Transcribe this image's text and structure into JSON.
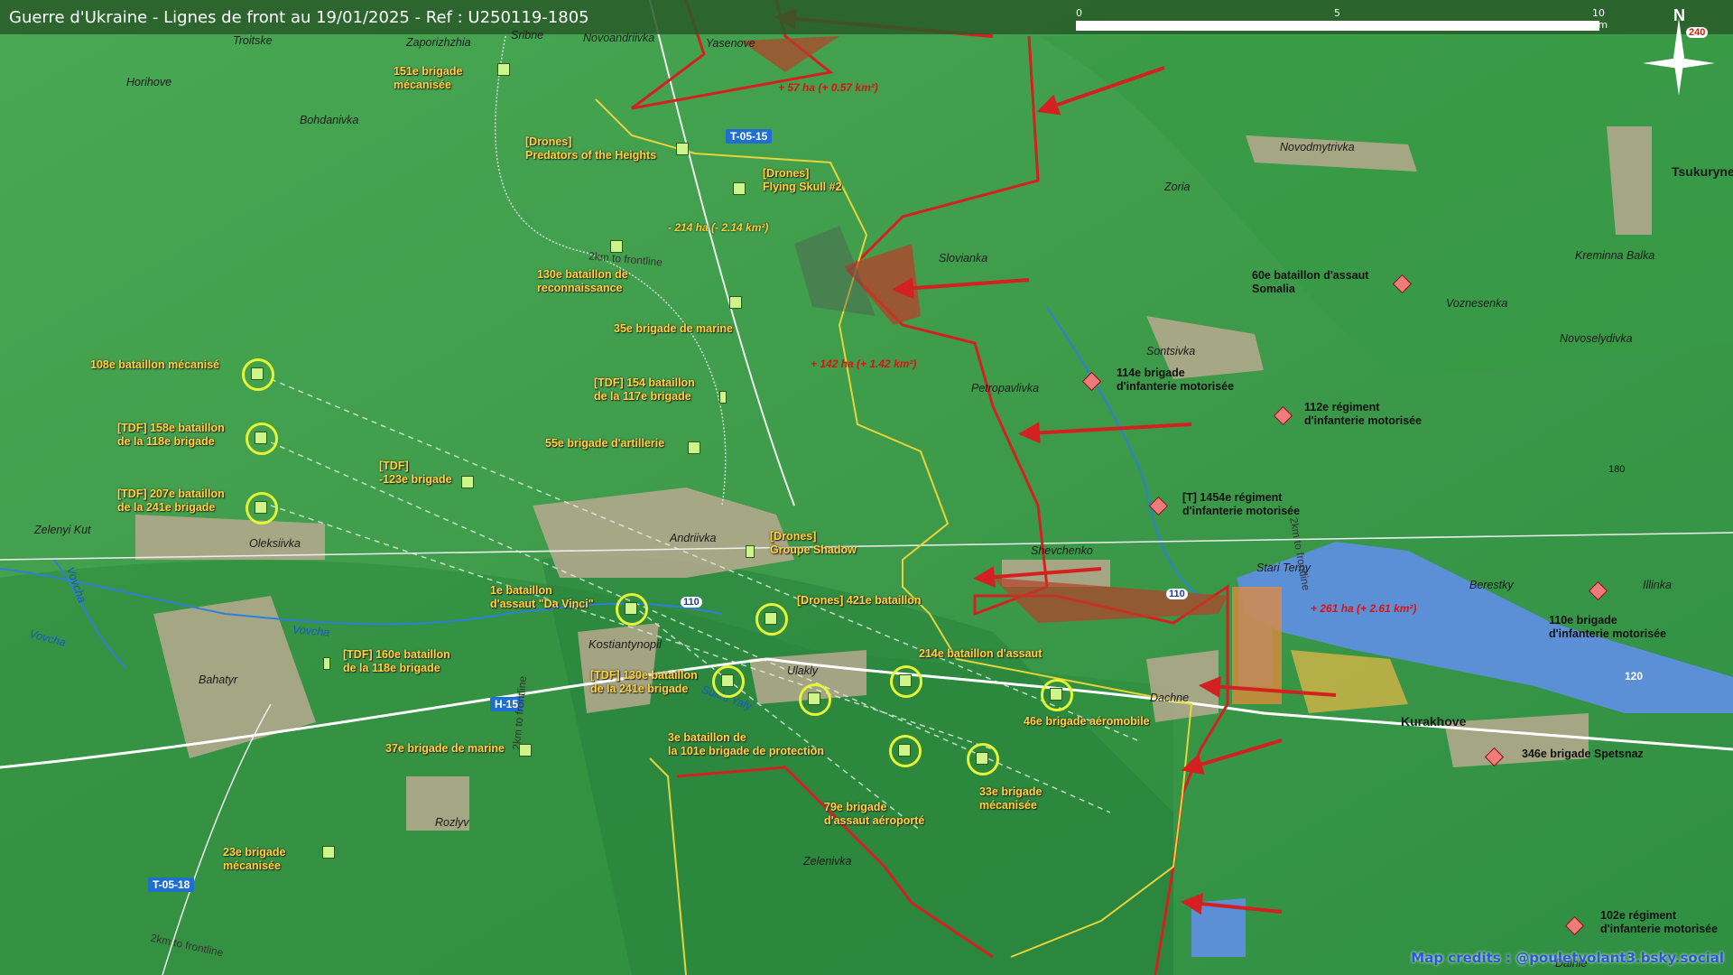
{
  "title": "Guerre d'Ukraine - Lignes de front au 19/01/2025 - Ref : U250119-1805",
  "scale": {
    "ticks": [
      "0",
      "5",
      "10 km"
    ]
  },
  "north": {
    "letter": "N",
    "road_badge": "240"
  },
  "towns": {
    "troitske": "Troitske",
    "zaporizhzhia": "Zaporizhzhia",
    "sribne": "Sribne",
    "novoandriivka": "Novoandriivka",
    "yasenove": "Yasenove",
    "horihove": "Horihove",
    "bohdanivka": "Bohdanivka",
    "novodmytrivka": "Novodmytrivka",
    "tsukuryne": "Tsukuryne",
    "zoria": "Zoria",
    "slovianka": "Slovianka",
    "kreminna_balka": "Kreminna Balka",
    "voznesenka": "Voznesenka",
    "novoselydivka": "Novoselydivka",
    "sontsivka": "Sontsivka",
    "petropavlivka": "Petropavlivka",
    "zelenyi_kut": "Zelenyi Kut",
    "oleksiivka": "Oleksiivka",
    "andriivka": "Andriivka",
    "shevchenko": "Shevchenko",
    "stari_terny": "Stari Terny",
    "berestky": "Berestky",
    "illinka": "Illinka",
    "kostiantynopil": "Kostiantynopil",
    "ulakly": "Ulakly",
    "dachne": "Dachne",
    "kurakhove": "Kurakhove",
    "bahatyr": "Bahatyr",
    "rozlyv": "Rozlyv",
    "zelenivka": "Zelenivka",
    "dalnie": "Dalnie"
  },
  "water": {
    "vovcha1": "Vovcha",
    "vovcha2": "Vovcha",
    "vovcha3": "Vovcha",
    "sukhi_yaly": "Sukhi Yaly"
  },
  "roads": {
    "t0515": "T-05-15",
    "h15": "H-15",
    "t0518": "T-05-18",
    "r110a": "110",
    "r110b": "110",
    "r120": "120",
    "r180": "180"
  },
  "frontline_notes": {
    "a": "2km to frontline",
    "b": "2km to frontline",
    "c": "2km to frontline",
    "d": "2km to frontline"
  },
  "changes": {
    "g1": "+ 57 ha (+ 0.57 km²)",
    "g2": "- 214 ha (- 2.14 km²)",
    "g3": "+ 142 ha (+ 1.42 km²)",
    "g4": "+ 261 ha (+ 2.61 km²)"
  },
  "ua_units": {
    "u151": "151e brigade\nmécanisée",
    "predators": "[Drones]\nPredators of the Heights",
    "skull": "[Drones]\nFlying Skull #2",
    "b130": "130e bataillon de\nreconnaissance",
    "m35": "35e brigade de marine",
    "b108": "108e bataillon mécanisé",
    "tdf154": "[TDF] 154 bataillon\nde la 117e brigade",
    "tdf158": "[TDF] 158e bataillon\nde la 118e brigade",
    "art55": "55e brigade d'artillerie",
    "tdf123": "[TDF]\n-123e brigade",
    "tdf207": "[TDF] 207e bataillon\nde la 241e brigade",
    "shadow": "[Drones]\nGroupe Shadow",
    "davinci": "1e bataillon\nd'assaut \"Da Vinci\"",
    "b421": "[Drones] 421e bataillon",
    "tdf160": "[TDF] 160e bataillon\nde la 118e brigade",
    "b214": "214e bataillon d'assaut",
    "tdf130": "[TDF] 130e bataillon\nde la 241e brigade",
    "air46": "46e brigade aéromobile",
    "m37": "37e brigade de marine",
    "b3": "3e bataillon de\nla 101e brigade de protection",
    "mech33": "33e brigade\nmécanisée",
    "air79": "79e brigade\nd'assaut aéroporté",
    "mech23": "23e brigade\nmécanisée"
  },
  "ru_units": {
    "r60": "60e bataillon d'assaut\nSomalia",
    "r114": "114e brigade\nd'infanterie motorisée",
    "r112": "112e régiment\nd'infanterie motorisée",
    "r1454": "[T] 1454e régiment\nd'infanterie motorisée",
    "r110": "110e brigade\nd'infanterie motorisée",
    "r346": "346e brigade Spetsnaz",
    "r102": "102e régiment\nd'infanterie motorisée"
  },
  "credits": "Map credits : @pouletvolant3.bsky.social",
  "colors": {
    "russian_line": "#d42020",
    "ukrainian_line": "#e8d33a",
    "reservoir": "#5b8fd6",
    "urban": "#b9a98f"
  }
}
